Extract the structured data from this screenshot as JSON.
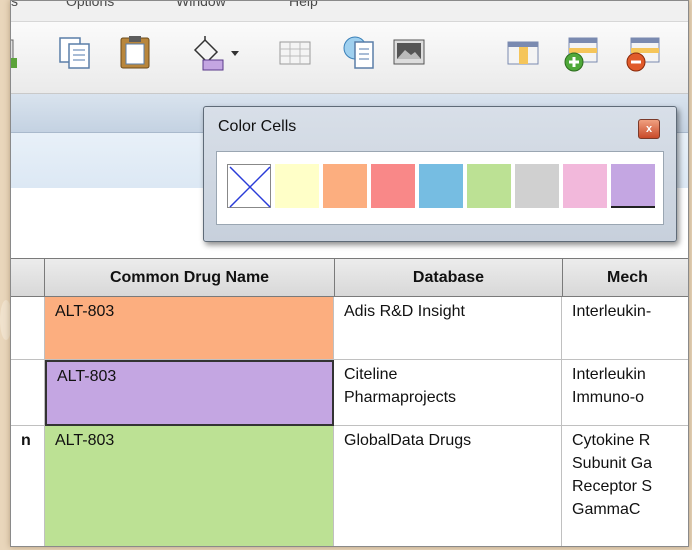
{
  "menubar": {
    "items": [
      "s",
      "Options",
      "Window",
      "Help"
    ]
  },
  "toolbar": {
    "icons": [
      "save-icon",
      "copy-document-icon",
      "clipboard-icon",
      "fill-color-bucket-icon",
      "dropdown-arrow-icon",
      "table-grid-icon",
      "export-document-icon",
      "image-icon",
      "columns-table-icon",
      "add-row-icon",
      "remove-row-icon"
    ]
  },
  "popup": {
    "title": "Color Cells",
    "close_label": "x",
    "swatches": [
      {
        "name": "none",
        "color": "#ffffff"
      },
      {
        "name": "yellow",
        "color": "#ffffc8"
      },
      {
        "name": "orange",
        "color": "#fcae7f"
      },
      {
        "name": "red",
        "color": "#f98888"
      },
      {
        "name": "blue",
        "color": "#76bde2"
      },
      {
        "name": "green",
        "color": "#bce194"
      },
      {
        "name": "gray",
        "color": "#d0d0d0"
      },
      {
        "name": "pink",
        "color": "#f2b8db"
      },
      {
        "name": "purple",
        "color": "#c4a6e2"
      }
    ]
  },
  "table": {
    "headers": [
      "",
      "Common Drug Name",
      "Database",
      "Mech"
    ],
    "rows": [
      {
        "col0": "",
        "drug": "ALT-803",
        "database": [
          "Adis R&D Insight"
        ],
        "mechanism": [
          "Interleukin-"
        ],
        "color": "#fcae7f"
      },
      {
        "col0": "",
        "drug": "ALT-803",
        "database": [
          "Citeline",
          "Pharmaprojects"
        ],
        "mechanism": [
          "Interleukin",
          "Immuno-o"
        ],
        "color": "#c4a6e2"
      },
      {
        "col0": "n",
        "drug": "ALT-803",
        "database": [
          "GlobalData Drugs"
        ],
        "mechanism": [
          "Cytokine R",
          "Subunit Ga",
          "Receptor S",
          "GammaC"
        ],
        "color": "#bce194"
      }
    ]
  }
}
